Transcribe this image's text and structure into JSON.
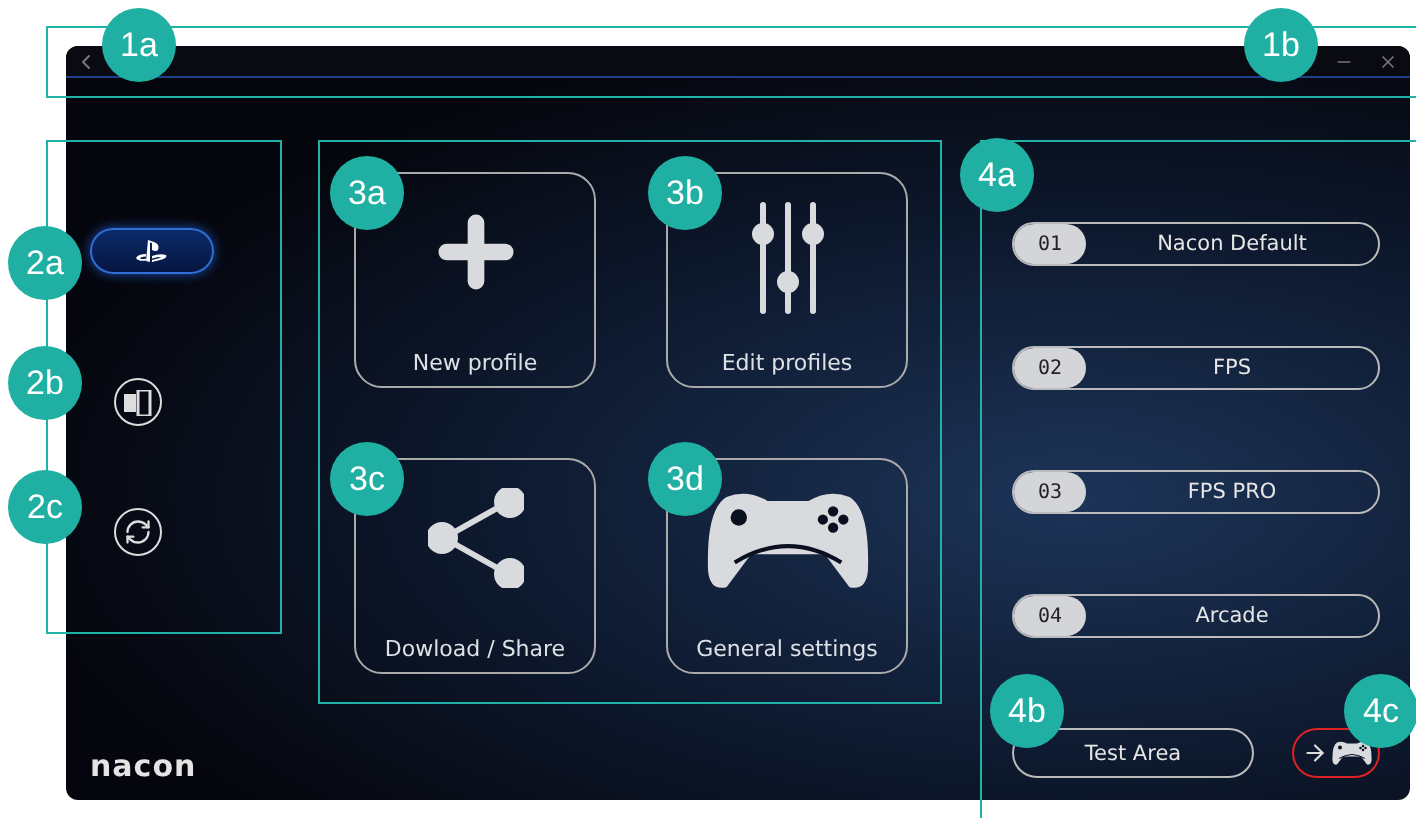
{
  "window": {
    "brand": "nacon"
  },
  "sidebar": {
    "items": [
      {
        "kind": "platform",
        "selected": true
      },
      {
        "kind": "pc",
        "selected": false
      },
      {
        "kind": "refresh",
        "selected": false
      }
    ]
  },
  "tiles": [
    {
      "kind": "plus",
      "label": "New profile"
    },
    {
      "kind": "sliders",
      "label": "Edit profiles"
    },
    {
      "kind": "share",
      "label": "Dowload / Share"
    },
    {
      "kind": "gamepad",
      "label": "General settings"
    }
  ],
  "profiles": [
    {
      "number": "01",
      "name": "Nacon Default"
    },
    {
      "number": "02",
      "name": "FPS"
    },
    {
      "number": "03",
      "name": "FPS PRO"
    },
    {
      "number": "04",
      "name": "Arcade"
    }
  ],
  "test_button": {
    "label": "Test Area"
  },
  "callouts": [
    {
      "label": "1a"
    },
    {
      "label": "1b"
    },
    {
      "label": "2a"
    },
    {
      "label": "2b"
    },
    {
      "label": "2c"
    },
    {
      "label": "3a"
    },
    {
      "label": "3b"
    },
    {
      "label": "3c"
    },
    {
      "label": "3d"
    },
    {
      "label": "4a"
    },
    {
      "label": "4b"
    },
    {
      "label": "4c"
    }
  ]
}
